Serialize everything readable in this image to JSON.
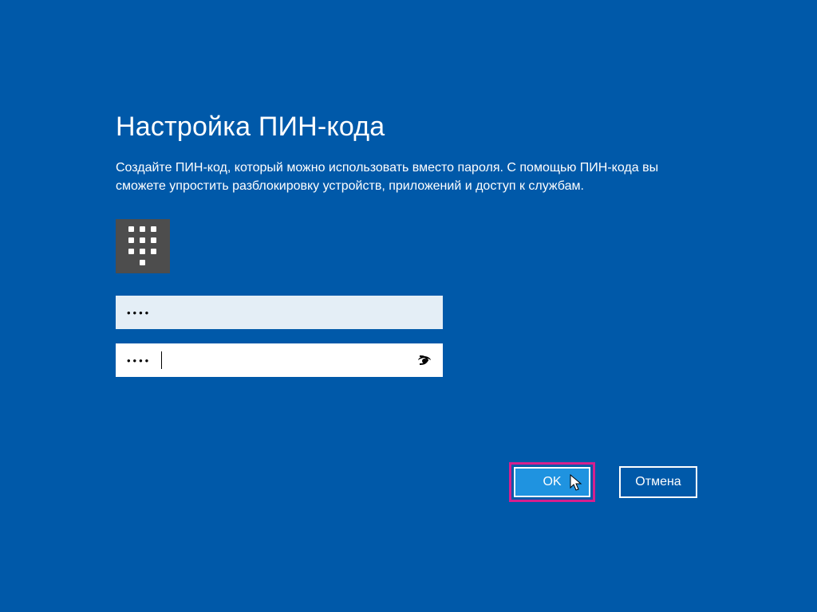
{
  "dialog": {
    "title": "Настройка ПИН-кода",
    "description": "Создайте ПИН-код, который можно использовать вместо пароля. С помощью ПИН-кода вы сможете упростить разблокировку устройств, приложений и доступ к службам."
  },
  "fields": {
    "pin_value_masked": "••••",
    "pin_confirm_masked": "••••"
  },
  "buttons": {
    "ok": "OK",
    "cancel": "Отмена"
  },
  "icons": {
    "keypad": "keypad-icon",
    "reveal": "password-reveal-eye-icon",
    "cursor": "mouse-cursor"
  },
  "colors": {
    "background": "#0059a9",
    "highlight_border": "#d61f8e",
    "ok_button_bg": "#1f93e0",
    "icon_box_bg": "#4d4d4d"
  }
}
